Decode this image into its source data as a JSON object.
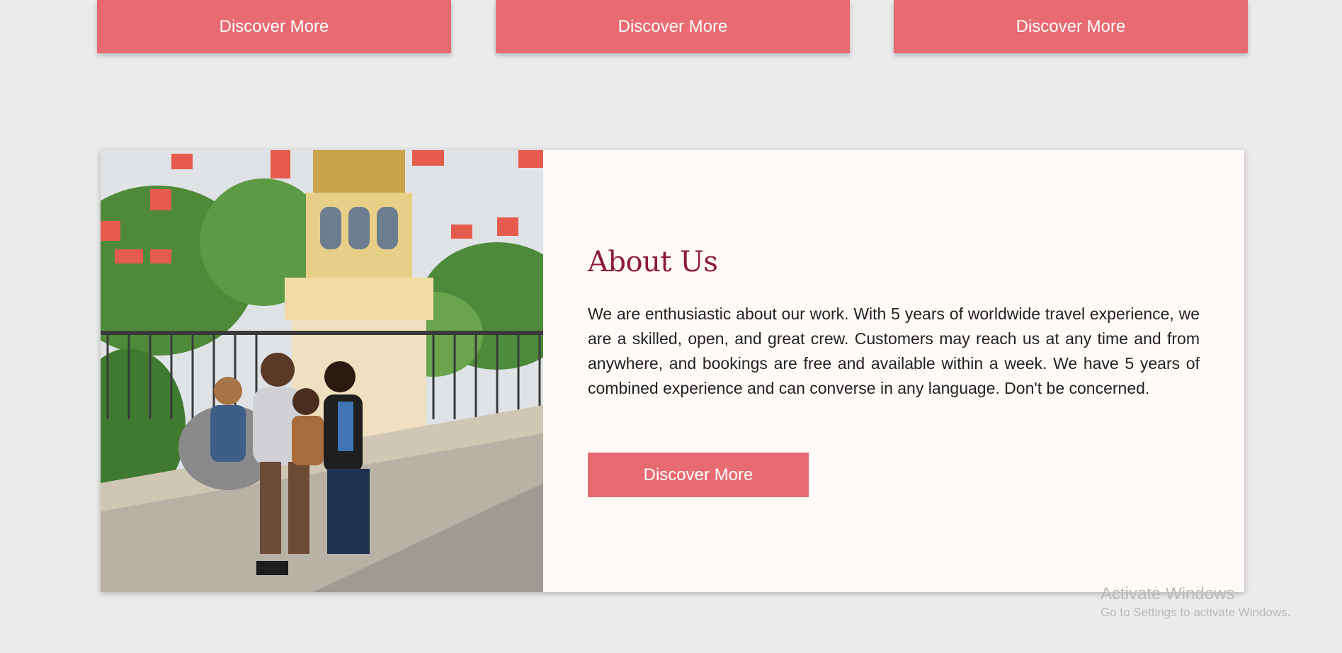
{
  "top_buttons": [
    {
      "label": "Discover More"
    },
    {
      "label": "Discover More"
    },
    {
      "label": "Discover More"
    }
  ],
  "about": {
    "title": "About Us",
    "body": "We are enthusiastic about our work. With 5 years of worldwide travel experience, we are a skilled, open, and great crew. Customers may reach us at any time and from anywhere, and bookings are free and available within a week. We have 5 years of combined experience and can converse in any language. Don't be concerned.",
    "button_label": "Discover More",
    "photo_icon": "family-amusement-park-photo"
  },
  "watermark": {
    "title": "Activate Windows",
    "subtitle": "Go to Settings to activate Windows."
  },
  "colors": {
    "background": "#ebebeb",
    "accent": "#e76b70",
    "title": "#8c1a3a",
    "card": "#fffaf7"
  }
}
